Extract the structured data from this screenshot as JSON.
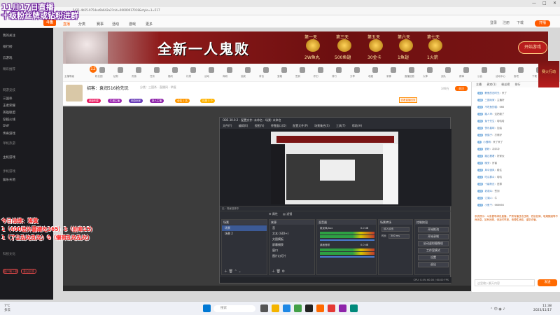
{
  "overlay": {
    "title_line1": "11月17日直播",
    "title_line2": "十级粉丝牌或钻粉进群",
    "today_label": "今日战绩：落寞",
    "record_line1": "1（400层外露蹭吃365）3（前辈15）",
    "record_line2": "1（了尘乱吃乱吃）0（懒哥乱吃乱吃）"
  },
  "browser": {
    "url": "...5431-4b55-9754ec6b642a2?cid=00000017018&style=1=517",
    "window_controls": [
      "—",
      "□",
      "✕"
    ]
  },
  "sitenav": {
    "logo": "斗鱼",
    "items": [
      "直播",
      "分类",
      "赛事",
      "活动",
      "游戏",
      "更多"
    ],
    "right_items": [
      "登录",
      "注册",
      "下载"
    ],
    "cta_label": "开播"
  },
  "sidebar": {
    "items": [
      "我的关注",
      "排行榜",
      "云游戏",
      "精彩推荐",
      "网游竞技",
      "三国杀",
      "王者荣耀",
      "英雄联盟",
      "穿越火线",
      "DNF",
      "传奇游戏",
      "单机热游",
      "主机游戏",
      "手机游戏",
      "娱乐天地",
      "科技文化"
    ],
    "buttons": [
      "客户端下载",
      "意见反馈"
    ]
  },
  "banner": {
    "headline": "全新一人鬼败",
    "days": [
      "第一天",
      "第三天",
      "第五天",
      "第六天",
      "第七天"
    ],
    "prizes": [
      "2W鱼丸",
      "500鱼翅",
      "30金卡",
      "1鱼翅",
      "1火箭"
    ],
    "play_label": "开始游戏"
  },
  "iconstrip": {
    "level": "12",
    "labels": [
      "主播等级",
      "粉丝团",
      "钻粉",
      "贵族",
      "任务",
      "福利",
      "礼物",
      "活动",
      "商城",
      "抽奖",
      "背包",
      "宝箱",
      "签到",
      "积分",
      "排行",
      "分享",
      "收藏",
      "录像",
      "直播回放",
      "大神",
      "战队",
      "赛事",
      "公会",
      "活动中心",
      "鱼吧",
      "下载"
    ]
  },
  "streamhead": {
    "title": "招客：袁润516抢先玩",
    "subtitle": "分类：三国杀 · 直播间 · 举报",
    "badges": [
      "超级明星",
      "牛逼主播",
      "网游玩家",
      "新人主播",
      "全站 1 名",
      "礼物 3 个"
    ],
    "right_badge": "查看直播回放",
    "viewer_count": "349万",
    "follow_label": "关注"
  },
  "obs": {
    "title": "OBS 30.0.2 - 配置文件: 未命名 - 场景: 未命名",
    "menu": [
      "文件(F)",
      "编辑(E)",
      "视图(V)",
      "停靠窗口(D)",
      "配置文件(P)",
      "场景集合(S)",
      "工具(T)",
      "帮助(H)"
    ],
    "scenebar_text": "无 · 场景选择中",
    "tools": [
      "属性",
      "滤镜"
    ],
    "scenes_title": "场景",
    "scenes": [
      "场景",
      "场景 2"
    ],
    "sources_title": "来源",
    "sources": [
      "音",
      "文本 (GDI+)",
      "文图模板",
      "屏幕捕获",
      "窗口",
      "图片幻灯片"
    ],
    "mixer_title": "混音器",
    "mixer_tracks": [
      "麦克风/Aux",
      "桌面音频"
    ],
    "mixer_levels": [
      "0.0 dB",
      "0.0 dB"
    ],
    "transition_title": "场景转场",
    "transition_type": "淡入淡出",
    "transition_duration_label": "时长",
    "transition_duration": "300 ms",
    "controls_title": "控制按钮",
    "controls": [
      "开始推流",
      "开始录制",
      "启动虚拟摄像机",
      "工作室模式",
      "设置",
      "退出"
    ],
    "status": "CPU: 0.4%   60.00 / 60.00 FPS"
  },
  "chat": {
    "tabs": [
      "主播",
      "贵宾(1)",
      "粉丝榜",
      "排行"
    ],
    "promo": "赛火行动",
    "messages": [
      {
        "level": "21",
        "nick": "鲸鱼的旧时光",
        "text": "来了"
      },
      {
        "level": "18",
        "nick": "三国玩家",
        "text": "主播好"
      },
      {
        "level": "25",
        "nick": "不吃鱼的猫",
        "text": "666"
      },
      {
        "level": "12",
        "nick": "路人甲",
        "text": "这把稳了"
      },
      {
        "level": "30",
        "nick": "兔子先生",
        "text": "哈哈哈"
      },
      {
        "level": "16",
        "nick": "快乐星球",
        "text": "加油"
      },
      {
        "level": "22",
        "nick": "夜猫子",
        "text": "打得好"
      },
      {
        "level": "9",
        "nick": "小透明",
        "text": "来了来了"
      },
      {
        "level": "27",
        "nick": "铁粉",
        "text": "冲冲冲"
      },
      {
        "level": "14",
        "nick": "路过看看",
        "text": "好家伙"
      },
      {
        "level": "19",
        "nick": "晚安",
        "text": "厉害"
      },
      {
        "level": "23",
        "nick": "风中追风",
        "text": "稳住"
      },
      {
        "level": "11",
        "nick": "吃瓜群众",
        "text": "哈哈"
      },
      {
        "level": "28",
        "nick": "十级粉丝",
        "text": "进群"
      },
      {
        "level": "15",
        "nick": "老观众",
        "text": "签到"
      },
      {
        "level": "20",
        "nick": "江湖人",
        "text": "牛"
      },
      {
        "level": "17",
        "nick": "小鱼干",
        "text": "666666"
      }
    ],
    "system_notice": "系统提示：斗鱼倡导绿色直播，严禁传播违法违规、低俗色情、吸烟酗酒等不良信息。如有违规，请及时举报。请理性消费，谨防诈骗。",
    "input_placeholder": "这里输入聊天内容",
    "send_label": "发送"
  },
  "taskbar": {
    "weather_temp": "7°C",
    "weather_desc": "多云",
    "search_placeholder": "搜索",
    "time": "11:38",
    "date": "2023/11/17"
  },
  "colors": {
    "accent": "#ff6a00",
    "overlay_red": "#ff2b2b",
    "overlay_purple": "#6a1b9a",
    "obs_bg": "#2b2d33"
  }
}
